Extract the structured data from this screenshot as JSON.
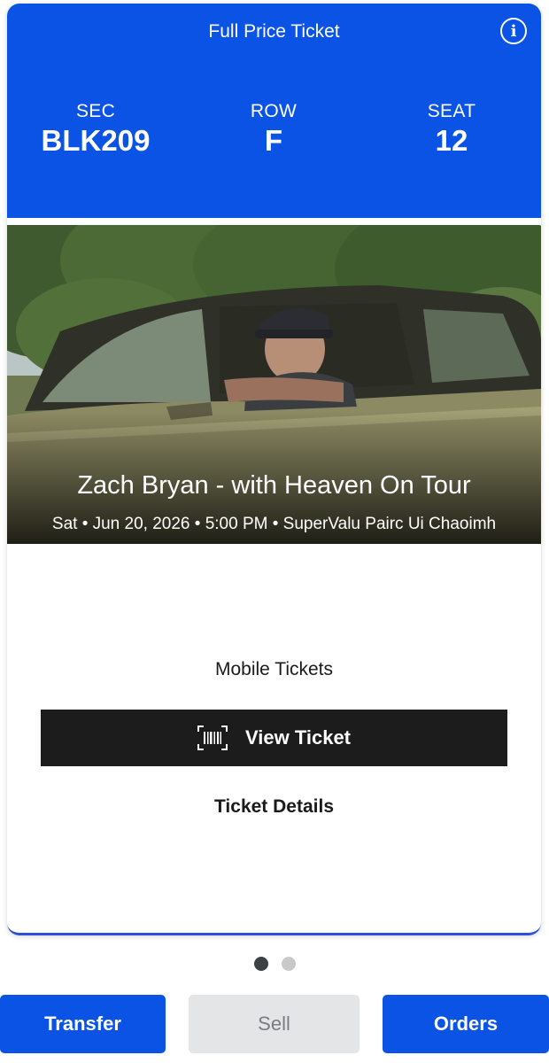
{
  "ticket": {
    "type_label": "Full Price Ticket",
    "info_icon": "info-icon",
    "section_label": "SEC",
    "section_value": "BLK209",
    "row_label": "ROW",
    "row_value": "F",
    "seat_label": "SEAT",
    "seat_value": "12",
    "header_color": "#0a53e5"
  },
  "event": {
    "title": "Zach Bryan - with Heaven On Tour",
    "meta": "Sat • Jun 20, 2026 • 5:00 PM • SuperValu Pairc Ui Chaoimh",
    "image": "event-photo-man-in-vintage-car"
  },
  "tickets": {
    "mobile_label": "Mobile Tickets",
    "view_ticket_label": "View Ticket",
    "view_ticket_icon": "barcode-icon",
    "details_label": "Ticket Details"
  },
  "pager": {
    "count": 2,
    "active_index": 0
  },
  "actions": {
    "transfer_label": "Transfer",
    "sell_label": "Sell",
    "orders_label": "Orders",
    "primary_color": "#0a53e5",
    "disabled_color": "#e4e5e7"
  }
}
